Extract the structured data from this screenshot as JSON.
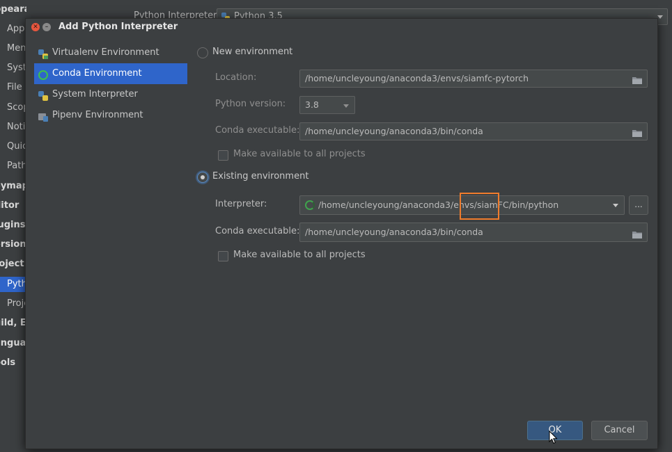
{
  "background": {
    "sidebar_items": [
      {
        "label": "ppearance & Behavior",
        "style": "bold"
      },
      {
        "label": "Appe",
        "style": "normal"
      },
      {
        "label": "Men",
        "style": "normal"
      },
      {
        "label": "Syst",
        "style": "normal"
      },
      {
        "label": "File C",
        "style": "normal"
      },
      {
        "label": "Scop",
        "style": "normal"
      },
      {
        "label": "Notif",
        "style": "normal"
      },
      {
        "label": "Quic",
        "style": "normal"
      },
      {
        "label": "Path",
        "style": "normal"
      },
      {
        "label": "eymap",
        "style": "bold"
      },
      {
        "label": "ditor",
        "style": "bold"
      },
      {
        "label": "lugins",
        "style": "bold"
      },
      {
        "label": "ersion",
        "style": "bold"
      },
      {
        "label": "roject:",
        "style": "bold"
      },
      {
        "label": "Pyth",
        "style": "selected"
      },
      {
        "label": "Proje",
        "style": "normal"
      },
      {
        "label": "uild, E",
        "style": "bold"
      },
      {
        "label": "anguag",
        "style": "bold"
      },
      {
        "label": "ools",
        "style": "bold"
      }
    ],
    "interpreter_label": "Python Interpreter:",
    "interpreter_value": "Python 3.5"
  },
  "dialog": {
    "title": "Add Python Interpreter",
    "types": [
      {
        "label": "Virtualenv Environment",
        "icon": "python-icon"
      },
      {
        "label": "Conda Environment",
        "icon": "conda-icon"
      },
      {
        "label": "System Interpreter",
        "icon": "python-icon"
      },
      {
        "label": "Pipenv Environment",
        "icon": "pipenv-icon"
      }
    ],
    "selected_type": "Conda Environment",
    "new_env": {
      "radio_label": "New environment",
      "location_label": "Location:",
      "location_value": "/home/uncleyoung/anaconda3/envs/siamfc-pytorch",
      "python_version_label": "Python version:",
      "python_version_value": "3.8",
      "conda_exec_label": "Conda executable:",
      "conda_exec_value": "/home/uncleyoung/anaconda3/bin/conda",
      "make_available_label": "Make available to all projects"
    },
    "existing_env": {
      "radio_label": "Existing environment",
      "interpreter_label": "Interpreter:",
      "interpreter_value": "/home/uncleyoung/anaconda3/envs/siamFC/bin/python",
      "ellipsis_label": "...",
      "conda_exec_label": "Conda executable:",
      "conda_exec_value": "/home/uncleyoung/anaconda3/bin/conda",
      "make_available_label": "Make available to all projects"
    },
    "ok_label": "OK",
    "cancel_label": "Cancel"
  },
  "colors": {
    "selection": "#2f65ca",
    "highlight": "#f07c2c",
    "ok_button": "#365880"
  }
}
